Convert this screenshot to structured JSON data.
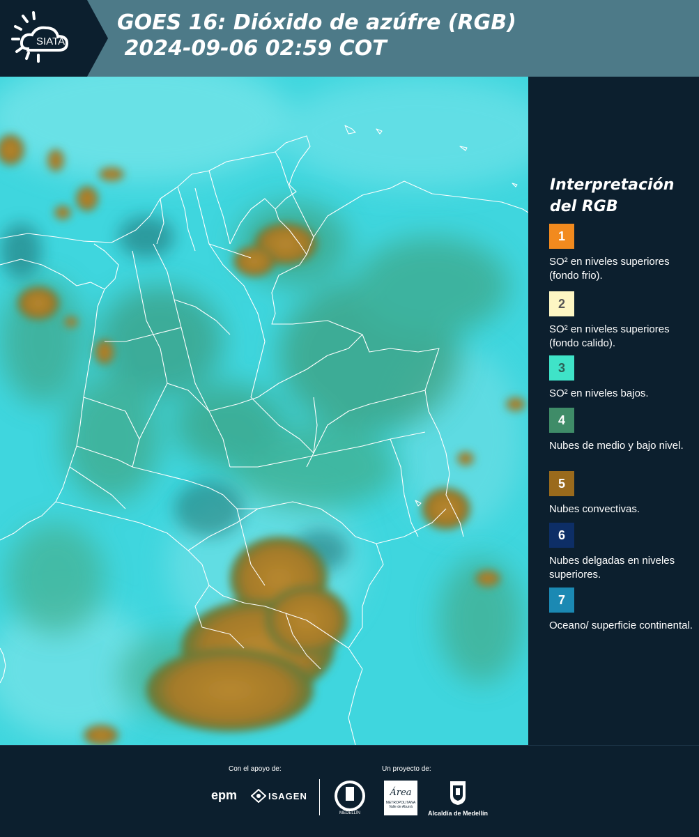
{
  "header": {
    "brand": "SIATA",
    "title_line1": "GOES 16: Dióxido de azúfre (RGB)",
    "title_line2": " 2024-09-06 02:59 COT"
  },
  "legend": {
    "title": "Interpretación del RGB",
    "items": [
      {
        "number": "1",
        "color": "#f28a1e",
        "text_color": "#ffffff",
        "label": "SO² en niveles superiores (fondo frio)."
      },
      {
        "number": "2",
        "color": "#fdf6c3",
        "text_color": "#555555",
        "label": "SO² en niveles superiores (fondo calido)."
      },
      {
        "number": "3",
        "color": "#3fe3c8",
        "text_color": "#2b5f55",
        "label": "SO² en niveles bajos."
      },
      {
        "number": "4",
        "color": "#3f8c68",
        "text_color": "#ffffff",
        "label": "Nubes de medio y bajo nivel."
      },
      {
        "number": "5",
        "color": "#9a6a1c",
        "text_color": "#ffffff",
        "label": "Nubes convectivas."
      },
      {
        "number": "6",
        "color": "#0d2e66",
        "text_color": "#ffffff",
        "label": "Nubes delgadas en niveles superiores."
      },
      {
        "number": "7",
        "color": "#1b89b3",
        "text_color": "#ffffff",
        "label": "Oceano/ superficie continental."
      }
    ]
  },
  "footer": {
    "support_caption": "Con el apoyo de:",
    "project_caption": "Un proyecto de:",
    "sponsors": {
      "epm": "epm",
      "isagen": "ISAGEN",
      "area_name": "Área",
      "area_sub1": "METROPOLITANA",
      "area_sub2": "Valle de Aburrá",
      "alcaldia": "Alcaldía de Medellín",
      "medellin_seal": "MEDELLÍN"
    }
  },
  "map_colors": {
    "background": "#3fd6de",
    "clouds_convective": "#a07a2c",
    "clouds_mid": "#3c9f7e",
    "borders": "#ffffff"
  }
}
